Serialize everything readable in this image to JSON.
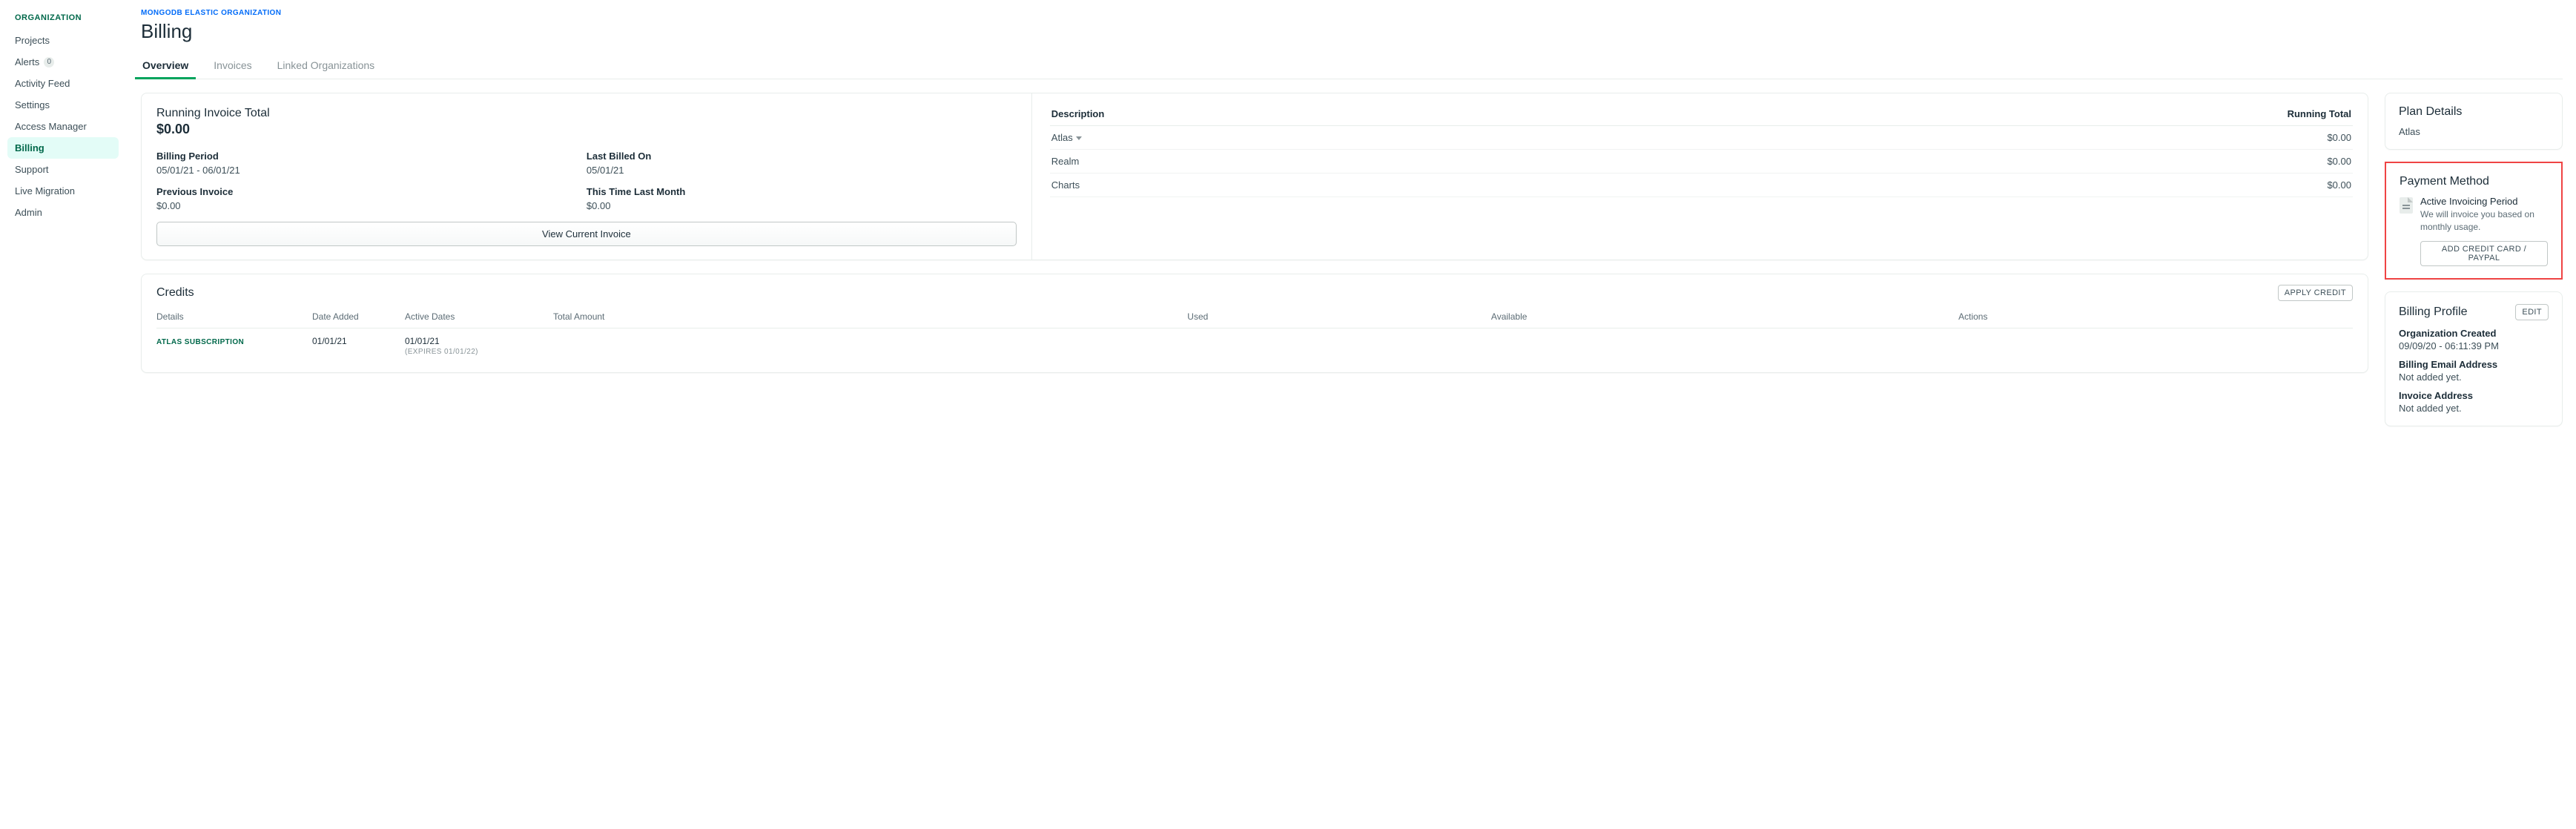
{
  "sidebar": {
    "heading": "ORGANIZATION",
    "items": [
      {
        "label": "Projects"
      },
      {
        "label": "Alerts",
        "badge": "0"
      },
      {
        "label": "Activity Feed"
      },
      {
        "label": "Settings"
      },
      {
        "label": "Access Manager"
      },
      {
        "label": "Billing",
        "active": true
      },
      {
        "label": "Support"
      },
      {
        "label": "Live Migration"
      },
      {
        "label": "Admin"
      }
    ]
  },
  "breadcrumb": "MONGODB ELASTIC ORGANIZATION",
  "page_title": "Billing",
  "tabs": {
    "overview": "Overview",
    "invoices": "Invoices",
    "linked": "Linked Organizations"
  },
  "running_invoice": {
    "title": "Running Invoice Total",
    "amount": "$0.00",
    "billing_period_label": "Billing Period",
    "billing_period_value": "05/01/21 - 06/01/21",
    "last_billed_label": "Last Billed On",
    "last_billed_value": "05/01/21",
    "previous_invoice_label": "Previous Invoice",
    "previous_invoice_value": "$0.00",
    "this_time_last_month_label": "This Time Last Month",
    "this_time_last_month_value": "$0.00",
    "view_button": "View Current Invoice"
  },
  "running_total_table": {
    "col_description": "Description",
    "col_total": "Running Total",
    "rows": [
      {
        "desc": "Atlas",
        "expandable": true,
        "total": "$0.00"
      },
      {
        "desc": "Realm",
        "total": "$0.00"
      },
      {
        "desc": "Charts",
        "total": "$0.00"
      }
    ]
  },
  "credits": {
    "title": "Credits",
    "apply_button": "APPLY CREDIT",
    "headers": {
      "details": "Details",
      "date_added": "Date Added",
      "active_dates": "Active Dates",
      "total_amount": "Total Amount",
      "used": "Used",
      "available": "Available",
      "actions": "Actions"
    },
    "rows": [
      {
        "details": "ATLAS SUBSCRIPTION",
        "date_added": "01/01/21",
        "active_from": "01/01/21",
        "expires": "(EXPIRES  01/01/22)"
      }
    ]
  },
  "plan_details": {
    "title": "Plan Details",
    "plan": "Atlas"
  },
  "payment_method": {
    "title": "Payment Method",
    "sub_title": "Active Invoicing Period",
    "sub_text": "We will invoice you based on monthly usage.",
    "button": "ADD CREDIT CARD / PAYPAL"
  },
  "billing_profile": {
    "title": "Billing Profile",
    "edit": "EDIT",
    "org_created_label": "Organization Created",
    "org_created_value": "09/09/20 - 06:11:39 PM",
    "email_label": "Billing Email Address",
    "email_value": "Not added yet.",
    "address_label": "Invoice Address",
    "address_value": "Not added yet."
  }
}
